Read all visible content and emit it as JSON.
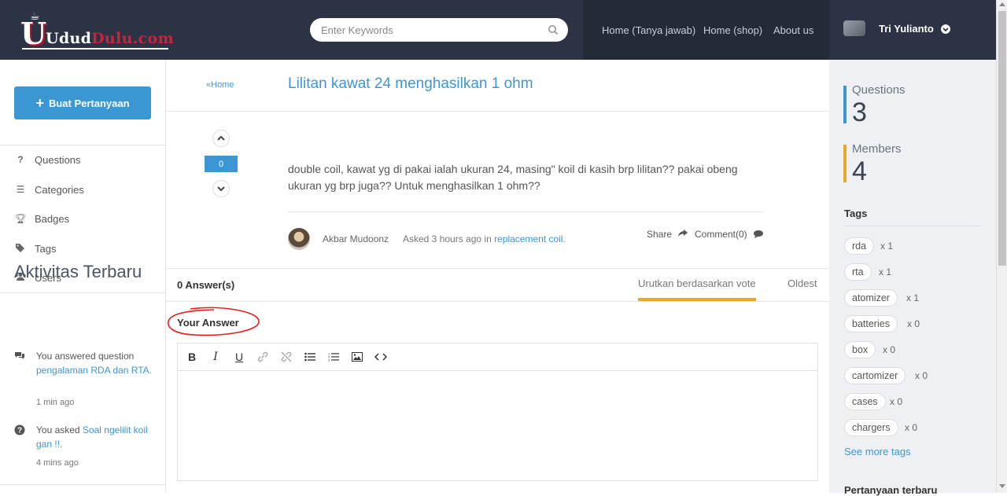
{
  "header": {
    "logo_text_1": "Udud",
    "logo_text_2": "Dulu",
    "logo_text_3": ".com",
    "search_placeholder": "Enter Keywords",
    "nav": [
      "Home (Tanya jawab)",
      "Home (shop)",
      "About us"
    ],
    "user_name": "Tri Yulianto"
  },
  "sidebar": {
    "ask_button": "Buat Pertanyaan",
    "menu": [
      {
        "label": "Questions",
        "icon": "question-icon"
      },
      {
        "label": "Categories",
        "icon": "list-icon"
      },
      {
        "label": "Badges",
        "icon": "trophy-icon"
      },
      {
        "label": "Tags",
        "icon": "tags-icon"
      },
      {
        "label": "Users",
        "icon": "users-icon"
      }
    ],
    "activity_title": "Aktivitas Terbaru",
    "activities": [
      {
        "prefix": "You answered question ",
        "link": "pengalaman RDA dan RTA.",
        "time": "1 min ago",
        "icon": "comments-icon"
      },
      {
        "prefix": "You asked ",
        "link": "Soal ngelilit koil gan !!.",
        "time": "4 mins ago",
        "icon": "question-circle-icon"
      }
    ]
  },
  "question": {
    "breadcrumb": "Home",
    "title": "Lilitan kawat 24 menghasilkan 1 ohm",
    "votes": "0",
    "body": "double coil, kawat yg di pakai ialah ukuran 24, masing\" koil di kasih brp lilitan?? pakai obeng ukuran yg brp juga?? Untuk menghasilkan 1 ohm??",
    "author": "Akbar Mudoonz",
    "asked_prefix": "Asked 3 hours ago in",
    "asked_tag": "replacement coil.",
    "share": "Share",
    "comment": "Comment(0)"
  },
  "answers": {
    "count_label": "0 Answer(s)",
    "sort_vote": "Urutkan berdasarkan vote",
    "sort_oldest": "Oldest",
    "your_answer": "Your Answer",
    "toolbar": [
      "B",
      "I",
      "U",
      "link",
      "unlink",
      "bullet-list",
      "numbered-list",
      "image",
      "code"
    ]
  },
  "right": {
    "questions_label": "Questions",
    "questions_count": "3",
    "members_label": "Members",
    "members_count": "4",
    "tags_title": "Tags",
    "tags": [
      {
        "name": "rda",
        "count": "x 1"
      },
      {
        "name": "rta",
        "count": "x 1"
      },
      {
        "name": "atomizer",
        "count": "x 1"
      },
      {
        "name": "batteries",
        "count": "x 0"
      },
      {
        "name": "box",
        "count": "x 0"
      },
      {
        "name": "cartomizer",
        "count": "x 0"
      },
      {
        "name": "cases",
        "count": "x 0"
      },
      {
        "name": "chargers",
        "count": "x 0"
      }
    ],
    "see_more": "See more tags",
    "recent_title": "Pertanyaan terbaru"
  },
  "colors": {
    "header_bg": "#2b3344",
    "accent_blue": "#3b97d3",
    "accent_orange": "#e7a82c",
    "logo_red": "#d0213a"
  }
}
